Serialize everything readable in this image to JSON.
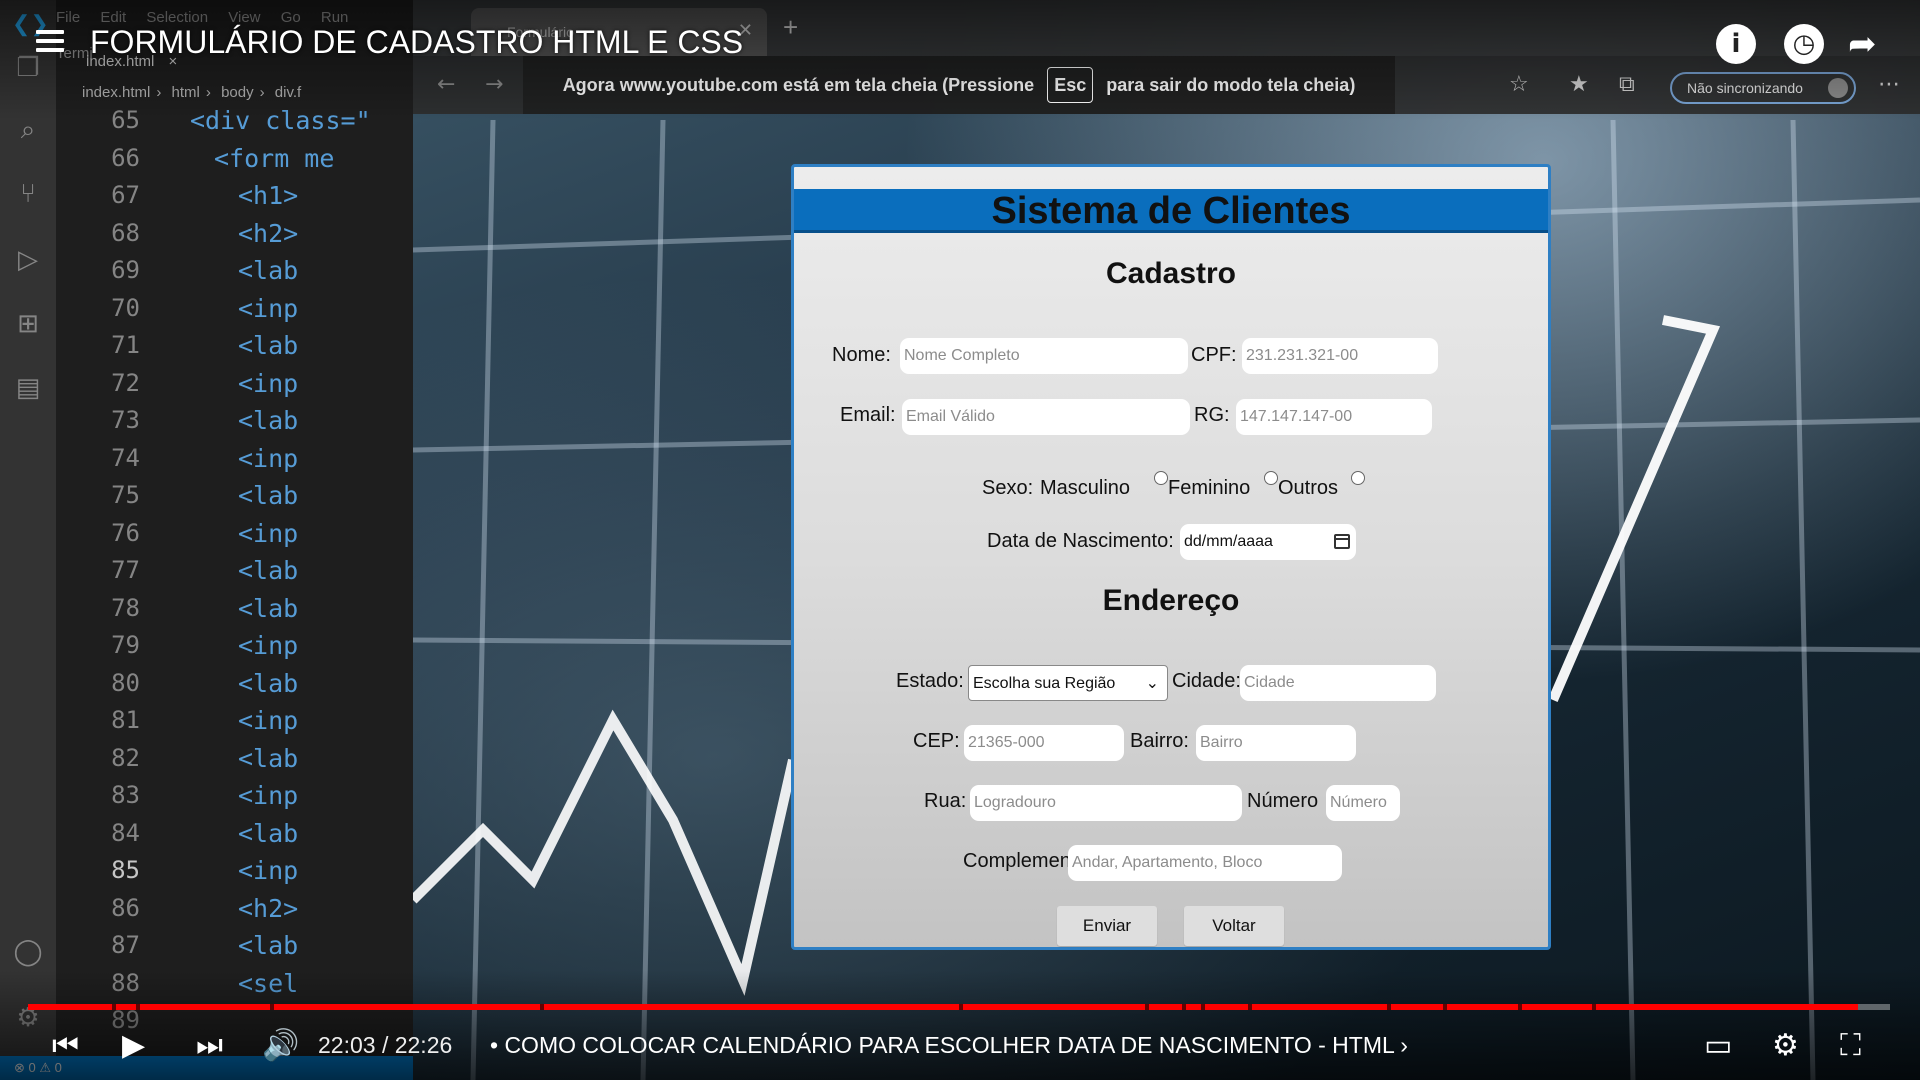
{
  "vscode": {
    "menu": [
      "File",
      "Edit",
      "Selection",
      "View",
      "Go",
      "Run",
      "Termi"
    ],
    "tab": "index.html",
    "breadcrumb": [
      "index.html",
      "html",
      "body",
      "div.f"
    ],
    "line_numbers": [
      "65",
      "66",
      "67",
      "68",
      "69",
      "70",
      "71",
      "72",
      "73",
      "74",
      "75",
      "76",
      "77",
      "78",
      "79",
      "80",
      "81",
      "82",
      "83",
      "84",
      "85",
      "86",
      "87",
      "88",
      "89"
    ],
    "active_line": "85",
    "code_lines": [
      "<div class=\"",
      "<form me",
      "<h1>",
      "<h2>",
      "<lab",
      "<inp",
      "<lab",
      "<inp",
      "<lab",
      "<inp",
      "<lab",
      "<inp",
      "<lab",
      "<lab",
      "<inp",
      "<lab",
      "<inp",
      "<lab",
      "<inp",
      "<lab",
      "<inp",
      "<h2>",
      "<lab",
      "<sel"
    ],
    "status": "⊗ 0 ⚠ 0"
  },
  "browser": {
    "tab_title": "Formulário",
    "sync_label": "Não sincronizando",
    "fullscreen_notice": {
      "before": "Agora www.youtube.com está em tela cheia (Pressione",
      "key": "Esc",
      "after": "para sair do modo tela cheia)"
    }
  },
  "form": {
    "title": "Sistema de Clientes",
    "section_cadastro": "Cadastro",
    "nome_label": "Nome:",
    "nome_placeholder": "Nome Completo",
    "cpf_label": "CPF:",
    "cpf_placeholder": "231.231.321-00",
    "email_label": "Email:",
    "email_placeholder": "Email Válido",
    "rg_label": "RG:",
    "rg_placeholder": "147.147.147-00",
    "sexo_label": "Sexo:",
    "sexo_options": [
      "Masculino",
      "Feminino",
      "Outros"
    ],
    "nascimento_label": "Data de Nascimento:",
    "nascimento_value": "dd/mm/aaaa",
    "section_endereco": "Endereço",
    "estado_label": "Estado:",
    "estado_selected": "Escolha sua Região",
    "cidade_label": "Cidade:",
    "cidade_placeholder": "Cidade",
    "cep_label": "CEP:",
    "cep_placeholder": "21365-000",
    "bairro_label": "Bairro:",
    "bairro_placeholder": "Bairro",
    "rua_label": "Rua:",
    "rua_placeholder": "Logradouro",
    "numero_label": "Número",
    "numero_placeholder": "Número",
    "complemento_label": "Complemento:",
    "complemento_placeholder": "Andar, Apartamento, Bloco",
    "enviar_label": "Enviar",
    "voltar_label": "Voltar"
  },
  "youtube": {
    "video_title": "FORMULÁRIO DE CADASTRO HTML E CSS",
    "time": "22:03 / 22:26",
    "chapter": "• COMO COLOCAR CALENDÁRIO PARA ESCOLHER DATA DE NASCIMENTO - HTML ›",
    "progress": 0.983,
    "accent": "#ff0000"
  },
  "colors": {
    "form_header": "#0a6ebd",
    "vscode_status": "#007acc"
  }
}
